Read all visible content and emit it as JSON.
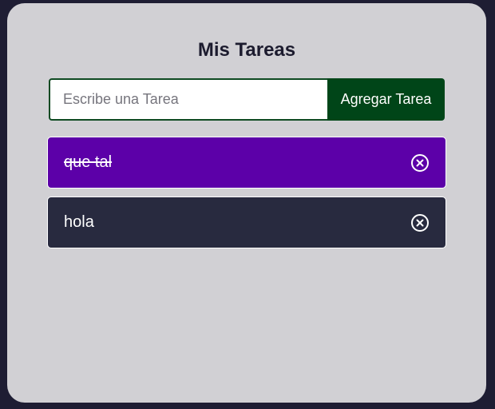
{
  "app": {
    "title": "Mis Tareas"
  },
  "form": {
    "input_placeholder": "Escribe una Tarea",
    "input_value": "",
    "add_button_label": "Agregar Tarea"
  },
  "tasks": [
    {
      "text": "que tal",
      "completed": true,
      "delete_icon": "close-circle-icon"
    },
    {
      "text": "hola",
      "completed": false,
      "delete_icon": "close-circle-icon"
    }
  ],
  "colors": {
    "page_background": "#1e1d33",
    "card_background": "#d1d0d4",
    "accent_green": "#004518",
    "completed_task": "#5c00a8",
    "pending_task": "#282a3f"
  }
}
